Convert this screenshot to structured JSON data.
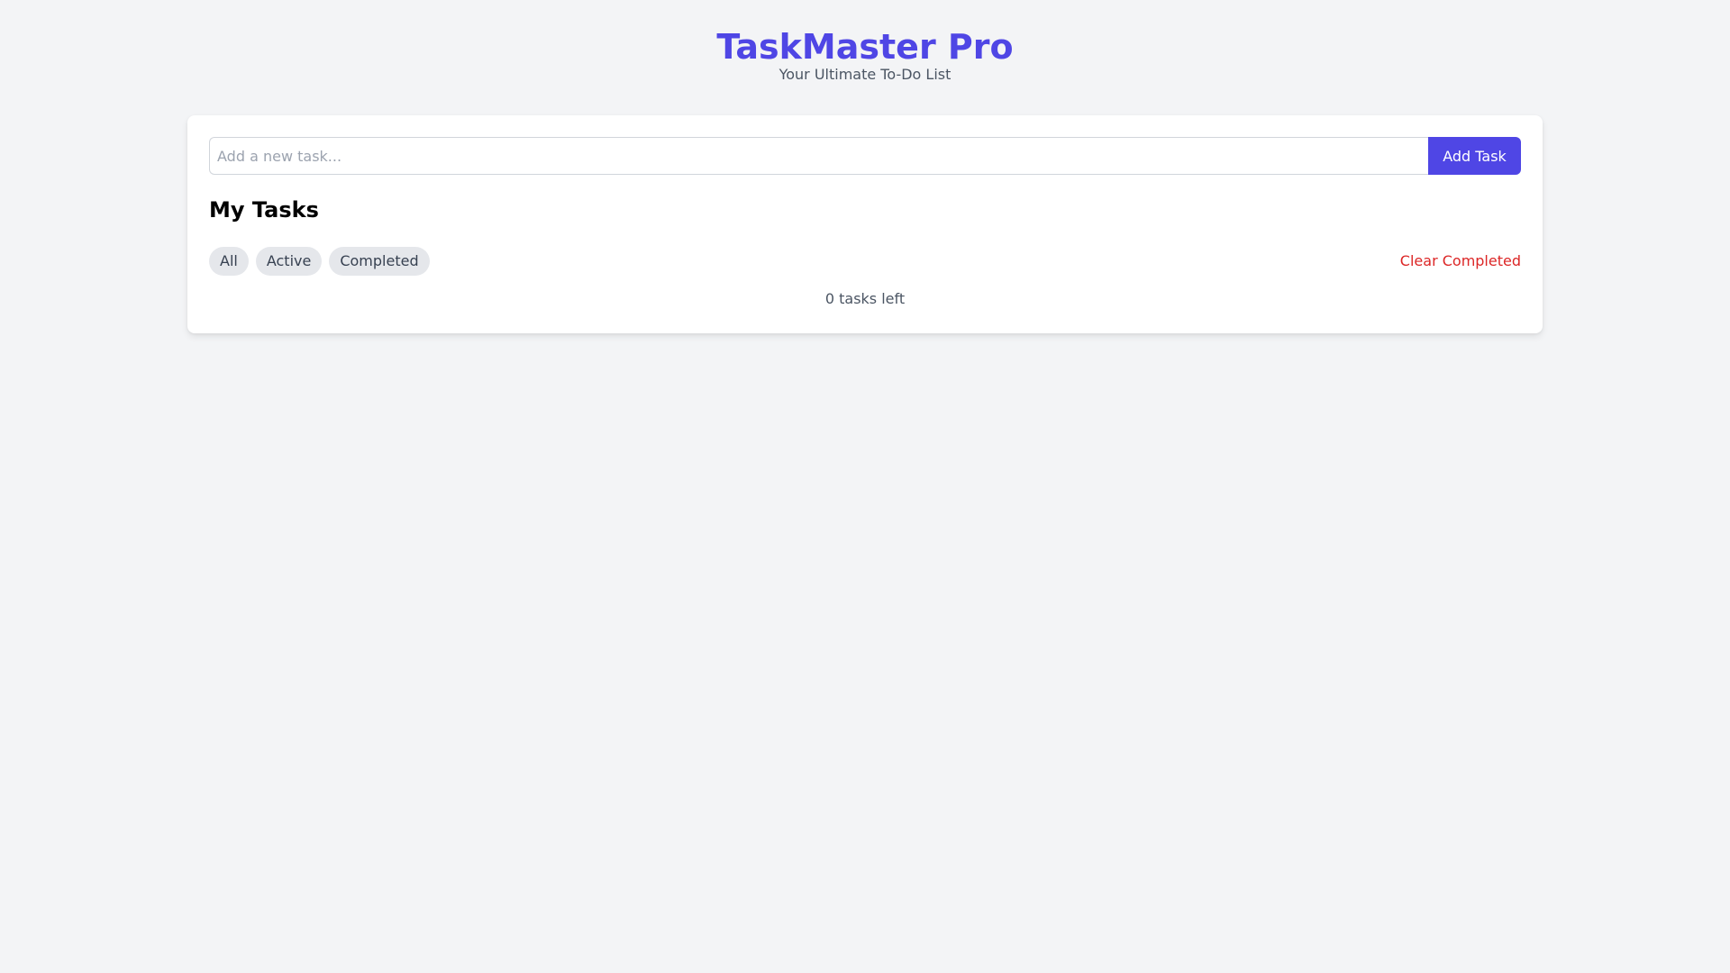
{
  "header": {
    "title": "TaskMaster Pro",
    "subtitle": "Your Ultimate To-Do List"
  },
  "add_task": {
    "placeholder": "Add a new task...",
    "value": "",
    "button_label": "Add Task"
  },
  "tasks_section": {
    "title": "My Tasks",
    "filters": [
      {
        "label": "All"
      },
      {
        "label": "Active"
      },
      {
        "label": "Completed"
      }
    ],
    "clear_label": "Clear Completed",
    "tasks_left": "0 tasks left"
  },
  "colors": {
    "accent": "#4f46e5",
    "danger": "#dc2626",
    "background": "#f3f4f6"
  }
}
